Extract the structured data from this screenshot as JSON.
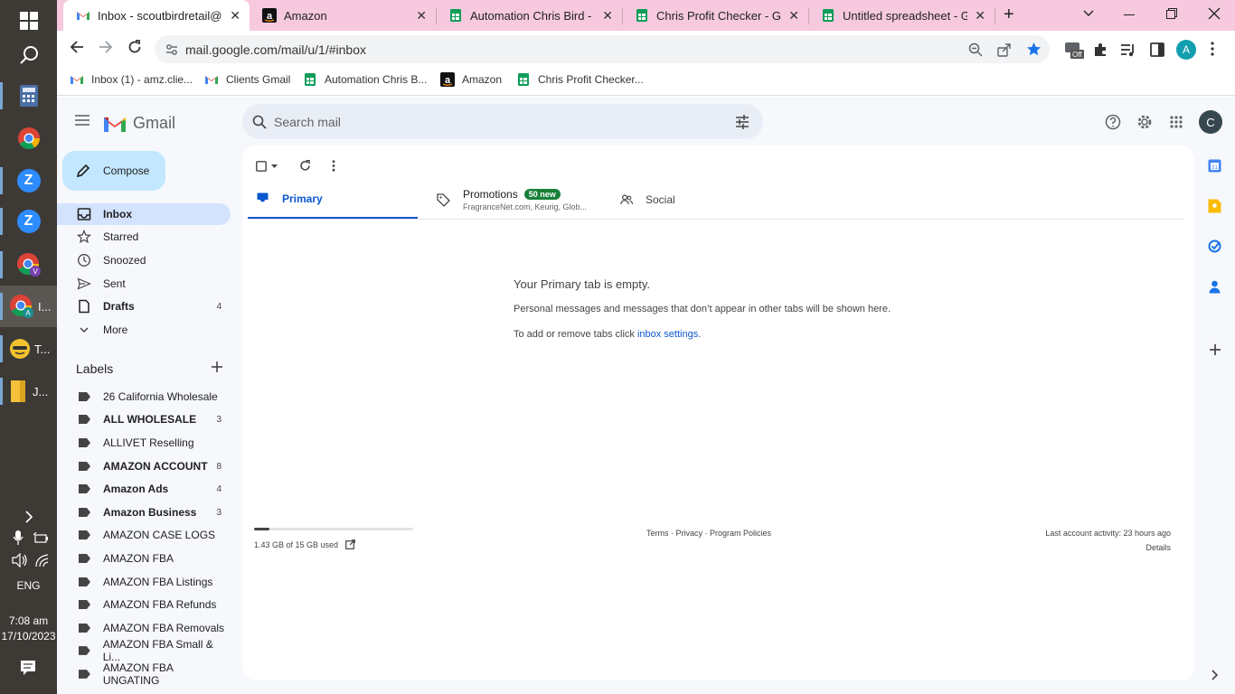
{
  "taskbar": {
    "items": [
      {
        "label": "",
        "icon": "calculator-icon"
      },
      {
        "label": "",
        "icon": "chrome-icon"
      },
      {
        "label": "",
        "icon": "zoom-icon"
      },
      {
        "label": "",
        "icon": "zoom-icon"
      },
      {
        "label": "",
        "icon": "chrome-profile-icon"
      },
      {
        "label": "I...",
        "icon": "chrome-profile-a-icon"
      },
      {
        "label": "T...",
        "icon": "emoji-app-icon"
      },
      {
        "label": "J...",
        "icon": "file-explorer-icon"
      }
    ],
    "language": "ENG",
    "time": "7:08 am",
    "date": "17/10/2023"
  },
  "browser": {
    "tabs": [
      {
        "title": "Inbox - scoutbirdretail@g",
        "icon": "gmail-icon",
        "active": true
      },
      {
        "title": "Amazon",
        "icon": "amazon-icon",
        "active": false
      },
      {
        "title": "Automation Chris Bird - G",
        "icon": "sheets-icon",
        "active": false
      },
      {
        "title": "Chris Profit Checker - Goo",
        "icon": "sheets-icon",
        "active": false
      },
      {
        "title": "Untitled spreadsheet - Go",
        "icon": "sheets-icon",
        "active": false
      }
    ],
    "url": "mail.google.com/mail/u/1/#inbox",
    "profile_initial": "A",
    "extension_badge": "Off",
    "bookmarks": [
      {
        "label": "Inbox (1) - amz.clie...",
        "icon": "gmail-icon"
      },
      {
        "label": "Clients Gmail",
        "icon": "gmail-icon"
      },
      {
        "label": "Automation Chris B...",
        "icon": "sheets-icon"
      },
      {
        "label": "Amazon",
        "icon": "amazon-icon"
      },
      {
        "label": "Chris Profit Checker...",
        "icon": "sheets-icon"
      }
    ]
  },
  "gmail": {
    "brand": "Gmail",
    "search_placeholder": "Search mail",
    "account_initial": "C",
    "compose_label": "Compose",
    "nav": [
      {
        "label": "Inbox",
        "icon": "inbox-icon",
        "count": "",
        "selected": true
      },
      {
        "label": "Starred",
        "icon": "star-icon",
        "count": ""
      },
      {
        "label": "Snoozed",
        "icon": "clock-icon",
        "count": ""
      },
      {
        "label": "Sent",
        "icon": "send-icon",
        "count": ""
      },
      {
        "label": "Drafts",
        "icon": "draft-icon",
        "count": "4"
      },
      {
        "label": "More",
        "icon": "chevron-down-icon",
        "count": ""
      }
    ],
    "labels_heading": "Labels",
    "labels": [
      {
        "label": "26 California Wholesale",
        "count": "",
        "bold": false
      },
      {
        "label": "ALL WHOLESALE",
        "count": "3",
        "bold": true
      },
      {
        "label": "ALLIVET Reselling",
        "count": "",
        "bold": false
      },
      {
        "label": "AMAZON ACCOUNT",
        "count": "8",
        "bold": true
      },
      {
        "label": "Amazon Ads",
        "count": "4",
        "bold": true
      },
      {
        "label": "Amazon Business",
        "count": "3",
        "bold": true
      },
      {
        "label": "AMAZON CASE LOGS",
        "count": "",
        "bold": false
      },
      {
        "label": "AMAZON FBA",
        "count": "",
        "bold": false
      },
      {
        "label": "AMAZON FBA Listings",
        "count": "",
        "bold": false
      },
      {
        "label": "AMAZON FBA Refunds",
        "count": "",
        "bold": false
      },
      {
        "label": "AMAZON FBA Removals",
        "count": "",
        "bold": false
      },
      {
        "label": "AMAZON FBA Small & Li...",
        "count": "",
        "bold": false
      },
      {
        "label": "AMAZON FBA UNGATING",
        "count": "",
        "bold": false
      }
    ],
    "tabs": {
      "primary": "Primary",
      "promotions": "Promotions",
      "promotions_badge": "50 new",
      "promotions_snippet": "FragranceNet.com, Keurig, Glob...",
      "social": "Social"
    },
    "empty": {
      "title": "Your Primary tab is empty.",
      "line1": "Personal messages and messages that don’t appear in other tabs will be shown here.",
      "line2_prefix": "To add or remove tabs click ",
      "line2_link": "inbox settings",
      "line2_suffix": "."
    },
    "footer": {
      "storage": "1.43 GB of 15 GB used",
      "storage_fraction": 0.095,
      "links": "Terms · Privacy · Program Policies",
      "activity": "Last account activity: 23 hours ago",
      "details": "Details"
    }
  }
}
